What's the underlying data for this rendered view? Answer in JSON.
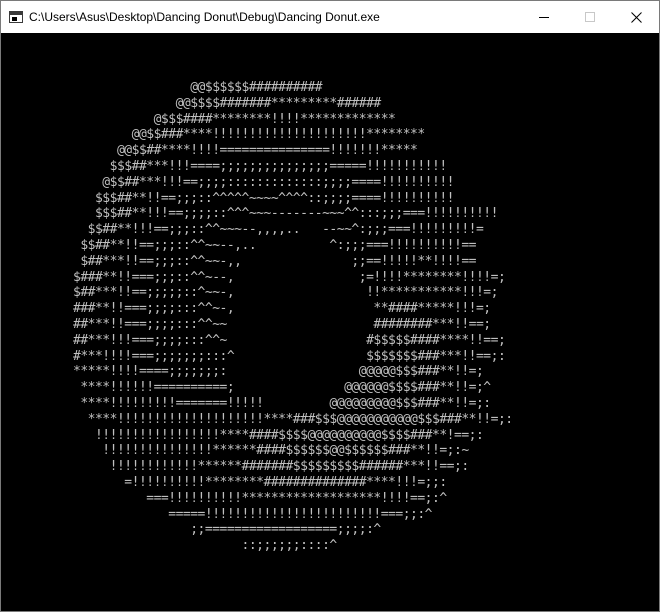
{
  "window": {
    "title": "C:\\Users\\Asus\\Desktop\\Dancing Donut\\Debug\\Dancing Donut.exe",
    "icon": "console-app-icon"
  },
  "controls": {
    "minimize_icon": "minimize-icon",
    "maximize_icon": "maximize-icon",
    "close_icon": "close-icon"
  },
  "console": {
    "background": "#000000",
    "text_color": "#c0c0c0",
    "output": "                @@$$$$$$##########\n              @@$$$$#######*********######\n           @$$$####********!!!!*************\n        @@$$###****!!!!!!!!!!!!!!!!!!!!!********\n      @@$$##****!!!!===============!!!!!!!*****\n     $$$##***!!!====;;;;;;;;;;;;;;;=====!!!!!!!!!!!\n    @$$##***!!!==;;;;:::::::::::::;;;;====!!!!!!!!!!\n   $$$##**!!==;;;::^^^^^~~~~^^^^::;;;;====!!!!!!!!!!\n   $$$##**!!!==;;;;::^^^~~~-------~~~^^:::;;;===!!!!!!!!!!\n  $$##**!!!==;;;::^^~~~--,,,,..   --~~^:;;;===!!!!!!!!!=\n $$##**!!==;;;::^^~~--,..          ^:;;;===!!!!!!!!!!==\n $##***!!==;;;::^^~~-,,               ;;==!!!!!**!!!!==\n$###**!!===;;;::^^~--,                 ;=!!!!********!!!!=;\n$##***!!==;;;;;::^~~-,                  !!***********!!!=;\n###**!!===;;;;:::^^~-,                   **####*****!!!=;\n##***!!===;;;;:::^^~~                    ########***!!==;\n##***!!!===;;;;:::^^~                   #$$$$$####****!!==;\n#***!!!!===;;;;;;;:::^                  $$$$$$$###***!!==;:\n*****!!!!====;;;;;;;:                  @@@@@$$$###**!!=;\n ****!!!!!!==========;               @@@@@@$$$$###**!!=;^\n ****!!!!!!!!!=======!!!!!         @@@@@@@@@$$$###**!!=;:\n  ****!!!!!!!!!!!!!!!!!!!!****###$$$@@@@@@@@@@@$$$###**!!=;:\n   !!!!!!!!!!!!!!!!!****####$$$$@@@@@@@@@@$$$$###**!==;:\n    !!!!!!!!!!!!!!!******####$$$$$$@@$$$$$$###**!!=;:~\n     !!!!!!!!!!!!******#######$$$$$$$$$######***!!==;:\n       =!!!!!!!!!!********##############****!!!=;;:\n          ===!!!!!!!!!!*******************!!!!==;:^\n             =====!!!!!!!!!!!!!!!!!!!!!!!!===;;:^\n                ;;==================;;;;:^\n                       ::;;;;;;::::^"
  }
}
